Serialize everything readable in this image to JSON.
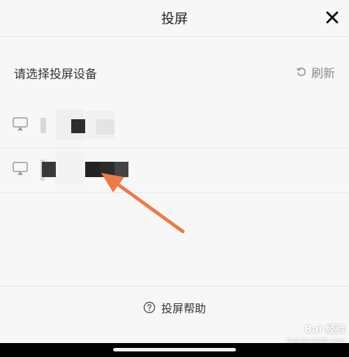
{
  "header": {
    "title": "投屏",
    "close_icon": "close-icon"
  },
  "section": {
    "title": "请选择投屏设备",
    "refresh_label": "刷新",
    "refresh_icon": "refresh-icon"
  },
  "devices": [
    {
      "name": "(pixelated)",
      "icon": "cast-screen-icon"
    },
    {
      "name": "(pixelated)",
      "icon": "cast-screen-icon"
    }
  ],
  "footer": {
    "help_label": "投屏帮助",
    "help_icon": "question-circle-icon"
  },
  "annotation": {
    "arrow_color": "#ee7a45"
  },
  "watermark": {
    "brand": "Bai 经验",
    "site": "jingyan.baidu.com"
  }
}
